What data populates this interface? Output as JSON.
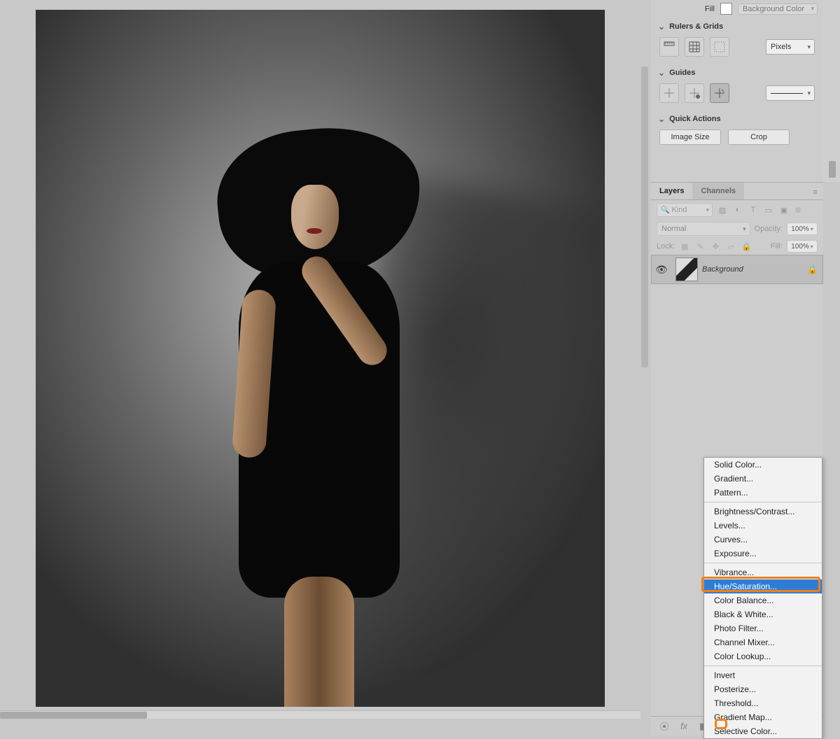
{
  "fill": {
    "label": "Fill",
    "mode": "Background Color"
  },
  "rulers": {
    "title": "Rulers & Grids",
    "units": "Pixels"
  },
  "guides": {
    "title": "Guides"
  },
  "quick_actions": {
    "title": "Quick Actions",
    "image_size": "Image Size",
    "crop": "Crop"
  },
  "layers_panel": {
    "tabs": {
      "layers": "Layers",
      "channels": "Channels"
    },
    "kind_label": "Kind",
    "blend_mode": "Normal",
    "opacity_label": "Opacity:",
    "opacity_value": "100%",
    "lock_label": "Lock:",
    "fill_label": "Fill:",
    "fill_value": "100%",
    "layer": {
      "name": "Background"
    }
  },
  "adjustment_menu": {
    "items": [
      "Solid Color...",
      "Gradient...",
      "Pattern...",
      "__sep__",
      "Brightness/Contrast...",
      "Levels...",
      "Curves...",
      "Exposure...",
      "__sep__",
      "Vibrance...",
      "Hue/Saturation...",
      "Color Balance...",
      "Black & White...",
      "Photo Filter...",
      "Channel Mixer...",
      "Color Lookup...",
      "__sep__",
      "Invert",
      "Posterize...",
      "Threshold...",
      "Gradient Map...",
      "Selective Color..."
    ],
    "highlighted": "Hue/Saturation..."
  }
}
